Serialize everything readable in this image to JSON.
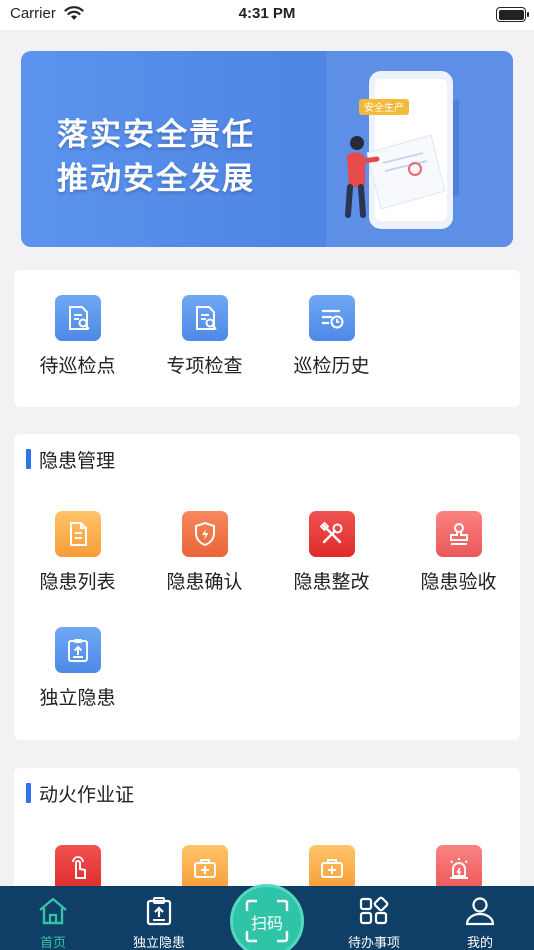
{
  "status_bar": {
    "carrier": "Carrier",
    "time": "4:31 PM"
  },
  "banner": {
    "line1": "落实安全责任",
    "line2": "推动安全发展",
    "tag": "安全生产"
  },
  "inspection": {
    "items": [
      {
        "label": "待巡检点",
        "icon": "doc-search-icon"
      },
      {
        "label": "专项检查",
        "icon": "doc-search-icon"
      },
      {
        "label": "巡检历史",
        "icon": "history-list-icon"
      }
    ]
  },
  "hazard": {
    "title": "隐患管理",
    "items": [
      {
        "label": "隐患列表",
        "icon": "document-icon"
      },
      {
        "label": "隐患确认",
        "icon": "shield-icon"
      },
      {
        "label": "隐患整改",
        "icon": "tools-icon"
      },
      {
        "label": "隐患验收",
        "icon": "stamp-icon"
      },
      {
        "label": "独立隐患",
        "icon": "clipboard-upload-icon"
      }
    ]
  },
  "hot_work": {
    "title": "动火作业证",
    "items": [
      {
        "icon": "hand-tap-icon"
      },
      {
        "icon": "medkit-icon"
      },
      {
        "icon": "medkit-icon"
      },
      {
        "icon": "alarm-icon"
      }
    ]
  },
  "tabbar": {
    "home": "首页",
    "independent": "独立隐患",
    "scan": "扫码",
    "todo": "待办事项",
    "mine": "我的"
  },
  "colors": {
    "primary": "#2f73e8",
    "tabbar_bg": "#0f3e66",
    "tab_active": "#34c3a6",
    "scan_bg": "#2fc4a8"
  }
}
